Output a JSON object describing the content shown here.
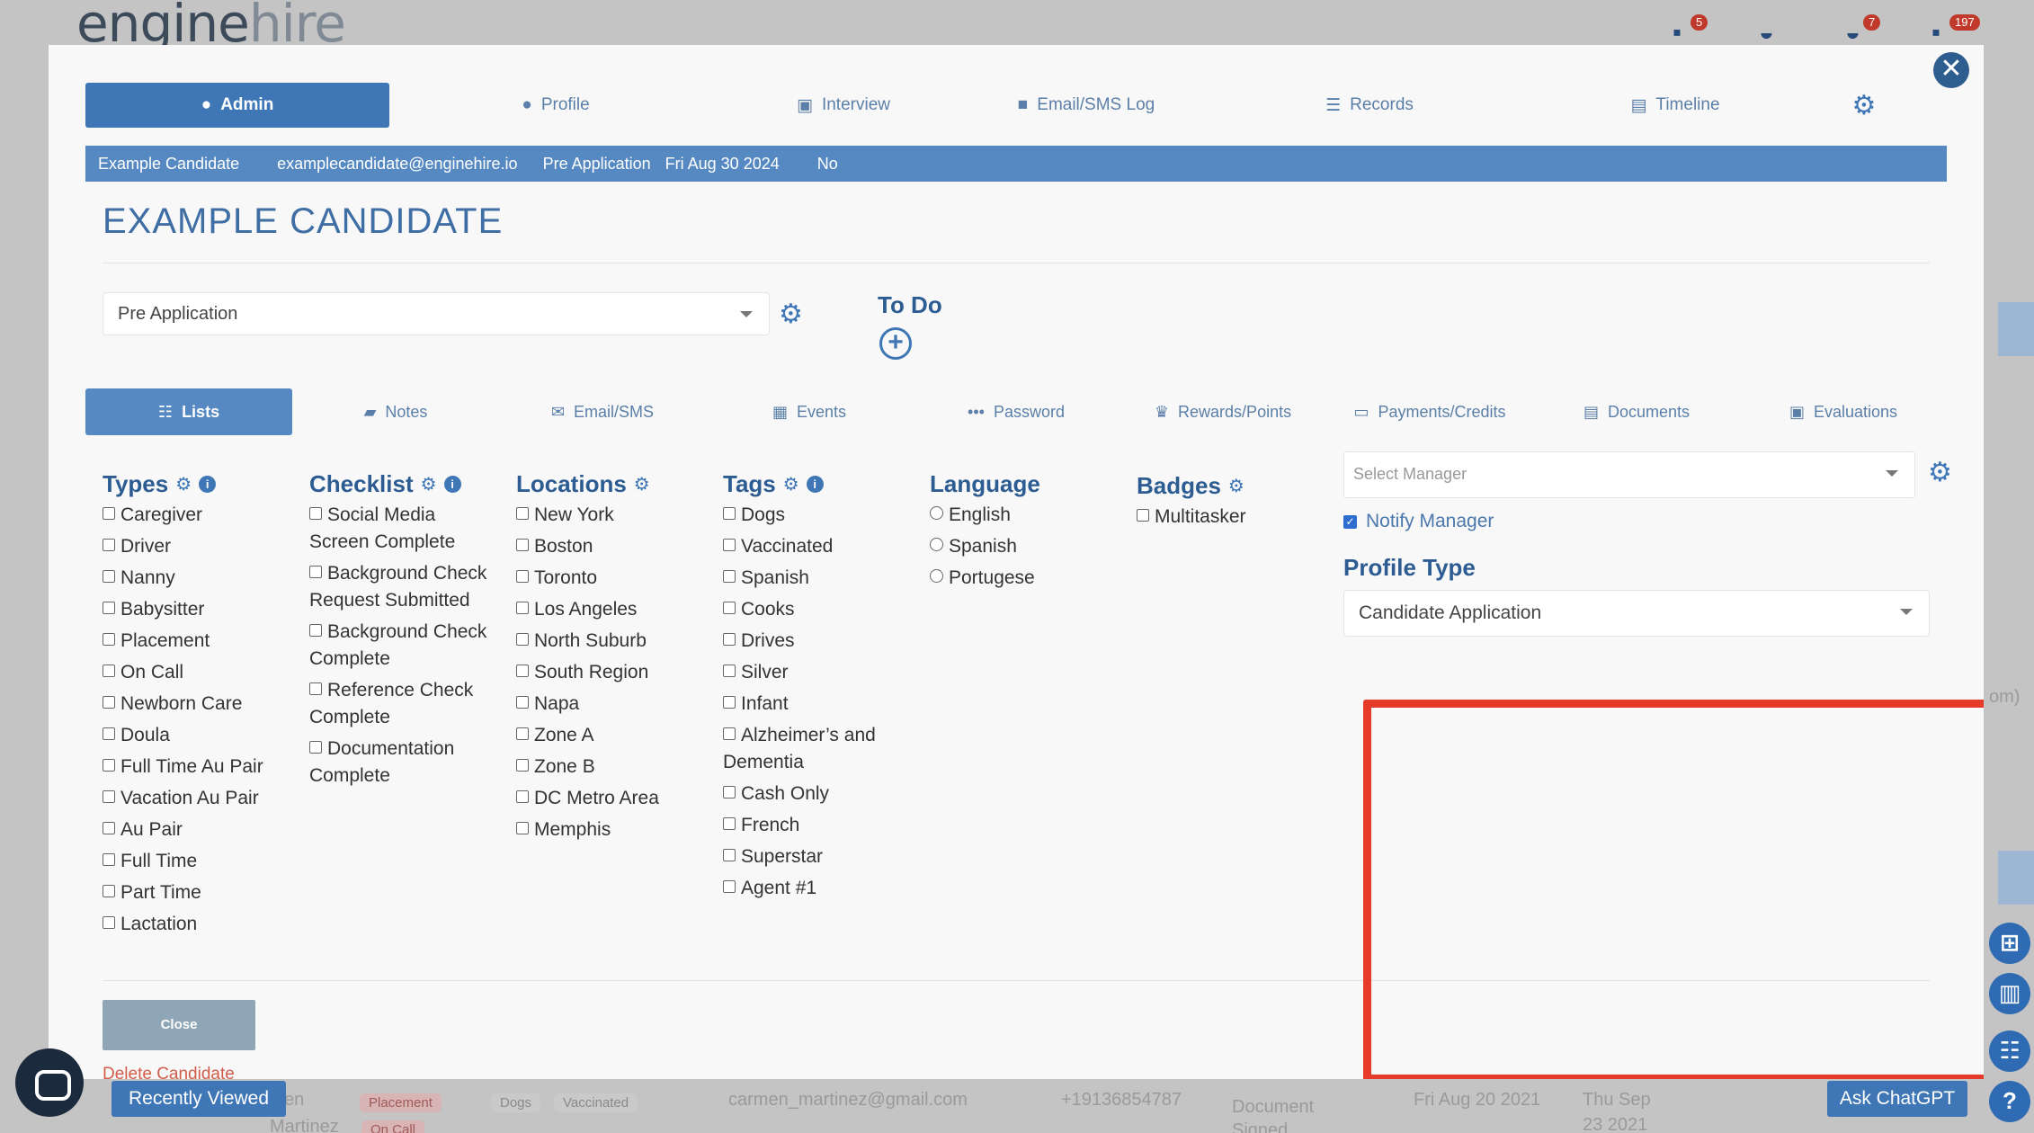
{
  "app": {
    "logo_main": "engine",
    "logo_accent": "hire"
  },
  "bg_badges": [
    "5",
    "7",
    "197"
  ],
  "bg_row": {
    "name_part": "en",
    "name_last": "Martinez",
    "tags": [
      "Placement",
      "Dogs",
      "Vaccinated",
      "On Call"
    ],
    "email": "carmen_martinez@gmail.com",
    "phone": "+19136854787",
    "status1": "Document",
    "status2": "Signed",
    "date1": "Fri Aug 20 2021",
    "date2a": "Thu Sep",
    "date2b": "23 2021",
    "edge_text": "om)"
  },
  "topnav": {
    "tabs": [
      {
        "label": "Admin",
        "icon": "user-cog-icon",
        "active": true
      },
      {
        "label": "Profile",
        "icon": "person-icon"
      },
      {
        "label": "Interview",
        "icon": "id-card-icon"
      },
      {
        "label": "Email/SMS Log",
        "icon": "comment-icon"
      },
      {
        "label": "Records",
        "icon": "list-icon"
      },
      {
        "label": "Timeline",
        "icon": "timeline-icon"
      }
    ]
  },
  "infobar": {
    "name": "Example Candidate",
    "email": "examplecandidate@enginehire.io",
    "status": "Pre Application",
    "date": "Fri Aug 30 2024",
    "flag": "No"
  },
  "candidate": {
    "title": "EXAMPLE CANDIDATE",
    "status_value": "Pre Application"
  },
  "todo": {
    "title": "To Do"
  },
  "subnav": {
    "tabs": [
      {
        "label": "Lists",
        "icon": "checklist-icon",
        "active": true
      },
      {
        "label": "Notes",
        "icon": "note-icon"
      },
      {
        "label": "Email/SMS",
        "icon": "envelope-icon"
      },
      {
        "label": "Events",
        "icon": "calendar-icon"
      },
      {
        "label": "Password",
        "icon": "dots-icon"
      },
      {
        "label": "Rewards/Points",
        "icon": "trophy-icon"
      },
      {
        "label": "Payments/Credits",
        "icon": "credit-card-icon"
      },
      {
        "label": "Documents",
        "icon": "document-icon"
      },
      {
        "label": "Evaluations",
        "icon": "clipboard-icon"
      }
    ]
  },
  "lists": {
    "types": {
      "title": "Types",
      "items": [
        "Caregiver",
        "Driver",
        "Nanny",
        "Babysitter",
        "Placement",
        "On Call",
        "Newborn Care",
        "Doula",
        "Full Time Au Pair",
        "Vacation Au Pair",
        "Au Pair",
        "Full Time",
        "Part Time",
        "Lactation"
      ]
    },
    "checklist": {
      "title": "Checklist",
      "items": [
        "Social Media Screen Complete",
        "Background Check Request Submitted",
        "Background Check Complete",
        "Reference Check Complete",
        "Documentation Complete"
      ]
    },
    "locations": {
      "title": "Locations",
      "items": [
        "New York",
        "Boston",
        "Toronto",
        "Los Angeles",
        "North Suburb",
        "South Region",
        "Napa",
        "Zone A",
        "Zone B",
        "DC Metro Area",
        "Memphis"
      ]
    },
    "tags": {
      "title": "Tags",
      "items": [
        "Dogs",
        "Vaccinated",
        "Spanish",
        "Cooks",
        "Drives",
        "Silver",
        "Infant",
        "Alzheimer’s and Dementia",
        "Cash Only",
        "French",
        "Superstar",
        "Agent #1"
      ]
    },
    "language": {
      "title": "Language",
      "items": [
        "English",
        "Spanish",
        "Portugese"
      ]
    },
    "badges": {
      "title": "Badges",
      "items": [
        "Multitasker"
      ]
    }
  },
  "manager": {
    "placeholder": "Select Manager",
    "notify_label": "Notify Manager",
    "notify_checked": true
  },
  "profile_type": {
    "title": "Profile Type",
    "value": "Candidate Application"
  },
  "footer": {
    "close_label": "Close",
    "delete_label": "Delete Candidate"
  },
  "floating": {
    "recently_viewed": "Recently Viewed",
    "ask_gpt": "Ask ChatGPT"
  },
  "colors": {
    "primary": "#3f77b6",
    "heading": "#2c5c92",
    "highlight": "#e63b2a"
  }
}
